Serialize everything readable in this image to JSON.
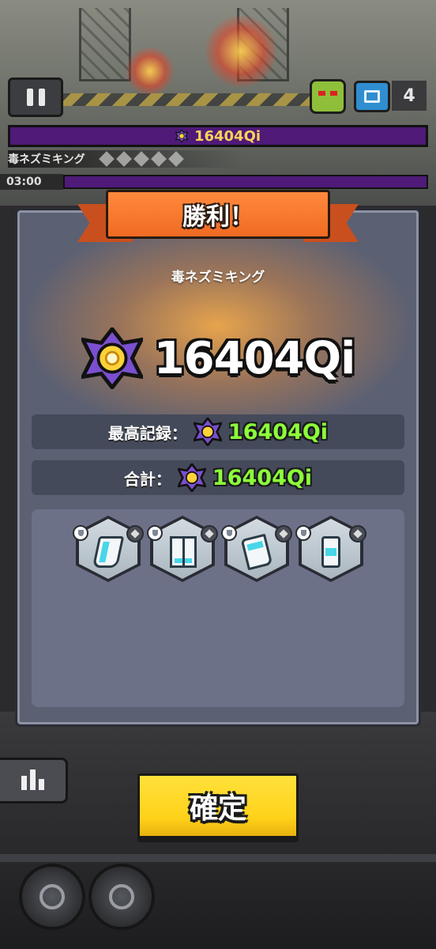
{
  "hud": {
    "boss_hp_value": "16404Qi",
    "boss_name": "毒ネズミキング",
    "timer": "03:00",
    "chest_count": "4"
  },
  "dialog": {
    "title": "勝利！",
    "stage_name": "毒ネズミキング",
    "score": "16404Qi",
    "best_record_label": "最高記録：",
    "best_record_value": "16404Qi",
    "total_label": "合計：",
    "total_value": "16404Qi",
    "rewards": [
      {
        "icon": "armor-chest-icon"
      },
      {
        "icon": "leg-armor-icon"
      },
      {
        "icon": "arm-guard-icon"
      },
      {
        "icon": "capsule-module-icon"
      }
    ]
  },
  "buttons": {
    "confirm_label": "確定"
  },
  "colors": {
    "ribbon": "#f06a22",
    "confirm": "#ffd21a",
    "stat_value": "#8cff3a",
    "dialog_bg": "#5b6073"
  }
}
